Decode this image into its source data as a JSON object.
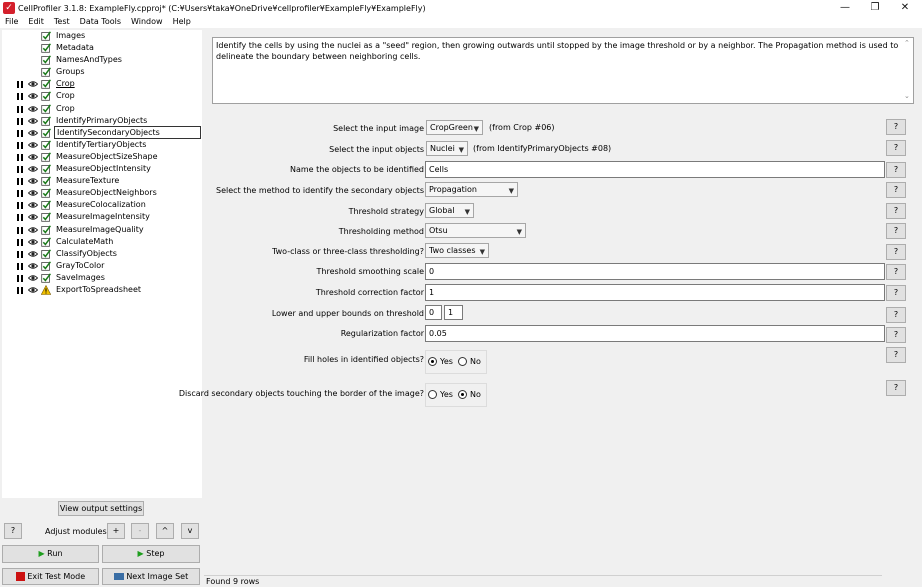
{
  "window": {
    "title": "CellProfiler 3.1.8: ExampleFly.cpproj* (C:¥Users¥taka¥OneDrive¥cellprofiler¥ExampleFly¥ExampleFly)",
    "minimize": "—",
    "restore": "❐",
    "close": "✕"
  },
  "menu": [
    "File",
    "Edit",
    "Test",
    "Data Tools",
    "Window",
    "Help"
  ],
  "modules": [
    {
      "label": "Images",
      "controls": false,
      "status": "check"
    },
    {
      "label": "Metadata",
      "controls": false,
      "status": "check"
    },
    {
      "label": "NamesAndTypes",
      "controls": false,
      "status": "check"
    },
    {
      "label": "Groups",
      "controls": false,
      "status": "check"
    },
    {
      "label": "Crop",
      "controls": true,
      "status": "check",
      "current": true
    },
    {
      "label": "Crop",
      "controls": true,
      "status": "check"
    },
    {
      "label": "Crop",
      "controls": true,
      "status": "check"
    },
    {
      "label": "IdentifyPrimaryObjects",
      "controls": true,
      "status": "check"
    },
    {
      "label": "IdentifySecondaryObjects",
      "controls": true,
      "status": "check",
      "selected": true
    },
    {
      "label": "IdentifyTertiaryObjects",
      "controls": true,
      "status": "check"
    },
    {
      "label": "MeasureObjectSizeShape",
      "controls": true,
      "status": "check"
    },
    {
      "label": "MeasureObjectIntensity",
      "controls": true,
      "status": "check"
    },
    {
      "label": "MeasureTexture",
      "controls": true,
      "status": "check"
    },
    {
      "label": "MeasureObjectNeighbors",
      "controls": true,
      "status": "check"
    },
    {
      "label": "MeasureColocalization",
      "controls": true,
      "status": "check"
    },
    {
      "label": "MeasureImageIntensity",
      "controls": true,
      "status": "check"
    },
    {
      "label": "MeasureImageQuality",
      "controls": true,
      "status": "check"
    },
    {
      "label": "CalculateMath",
      "controls": true,
      "status": "check"
    },
    {
      "label": "ClassifyObjects",
      "controls": true,
      "status": "check"
    },
    {
      "label": "GrayToColor",
      "controls": true,
      "status": "check"
    },
    {
      "label": "SaveImages",
      "controls": true,
      "status": "check"
    },
    {
      "label": "ExportToSpreadsheet",
      "controls": true,
      "status": "warning"
    }
  ],
  "left_panel": {
    "view_output_settings": "View output settings",
    "help": "?",
    "adjust_modules": "Adjust modules:",
    "add": "+",
    "remove": "-",
    "up": "^",
    "down": "v",
    "run": "Run",
    "step": "Step",
    "exit_test_mode": "Exit Test Mode",
    "next_image_set": "Next Image Set"
  },
  "help_text": "Identify the cells by using the nuclei as a \"seed\" region, then growing outwards until stopped by the image threshold or by a neighbor. The Propagation method is used to delineate the boundary between neighboring cells.",
  "settings": {
    "input_image": {
      "label": "Select the input image",
      "value": "CropGreen",
      "note": "(from Crop #06)"
    },
    "input_objects": {
      "label": "Select the input objects",
      "value": "Nuclei",
      "note": "(from IdentifyPrimaryObjects #08)"
    },
    "objects_name": {
      "label": "Name the objects to be identified",
      "value": "Cells"
    },
    "method": {
      "label": "Select the method to identify the secondary objects",
      "value": "Propagation"
    },
    "threshold_strategy": {
      "label": "Threshold strategy",
      "value": "Global"
    },
    "thresholding_method": {
      "label": "Thresholding method",
      "value": "Otsu"
    },
    "two_three_class": {
      "label": "Two-class or three-class thresholding?",
      "value": "Two classes"
    },
    "smoothing_scale": {
      "label": "Threshold smoothing scale",
      "value": "0"
    },
    "correction_factor": {
      "label": "Threshold correction factor",
      "value": "1"
    },
    "bounds": {
      "label": "Lower and upper bounds on threshold",
      "lower": "0",
      "upper": "1"
    },
    "regularization": {
      "label": "Regularization factor",
      "value": "0.05"
    },
    "fill_holes": {
      "label": "Fill holes in identified objects?",
      "yes": "Yes",
      "no": "No",
      "selected": "Yes"
    },
    "discard_border": {
      "label": "Discard secondary objects touching the border of the image?",
      "yes": "Yes",
      "no": "No",
      "selected": "No"
    },
    "help": "?"
  },
  "status": "Found 9 rows",
  "colors": {
    "check": "#1a7a1a",
    "warning": "#f0c000",
    "run_icon": "#1e9e1e",
    "stop_icon": "#cc1111"
  }
}
